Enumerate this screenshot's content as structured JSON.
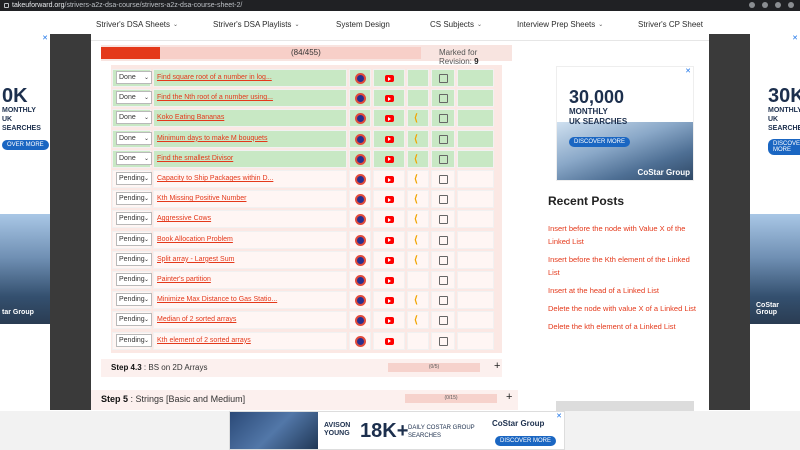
{
  "browser": {
    "url_host": "takeuforward.org",
    "url_path": "/strivers-a2z-dsa-course/strivers-a2z-dsa-course-sheet-2/"
  },
  "nav": {
    "items": [
      {
        "label": "Striver's DSA Sheets",
        "has_menu": true
      },
      {
        "label": "Striver's DSA Playlists",
        "has_menu": true
      },
      {
        "label": "System Design",
        "has_menu": false
      },
      {
        "label": "CS Subjects",
        "has_menu": true
      },
      {
        "label": "Interview Prep Sheets",
        "has_menu": true
      },
      {
        "label": "Striver's CP Sheet",
        "has_menu": false
      }
    ]
  },
  "progress": {
    "text": "(84/455)",
    "fraction": 0.1846,
    "revision_label": "Marked for Revision:",
    "revision_count": "9"
  },
  "problems": [
    {
      "status": "Done",
      "title": "Find square root of a number in log...",
      "leetcode": false
    },
    {
      "status": "Done",
      "title": "Find the Nth root of a number using...",
      "leetcode": false
    },
    {
      "status": "Done",
      "title": "Koko Eating Bananas",
      "leetcode": true
    },
    {
      "status": "Done",
      "title": "Minimum days to make M bouquets",
      "leetcode": true
    },
    {
      "status": "Done",
      "title": "Find the smallest Divisor",
      "leetcode": true
    },
    {
      "status": "Pending",
      "title": "Capacity to Ship Packages within D...",
      "leetcode": true
    },
    {
      "status": "Pending",
      "title": "Kth Missing Positive Number",
      "leetcode": true
    },
    {
      "status": "Pending",
      "title": "Aggressive Cows",
      "leetcode": true
    },
    {
      "status": "Pending",
      "title": "Book Allocation Problem",
      "leetcode": true
    },
    {
      "status": "Pending",
      "title": "Split array - Largest Sum",
      "leetcode": true
    },
    {
      "status": "Pending",
      "title": "Painter's partition",
      "leetcode": false
    },
    {
      "status": "Pending",
      "title": "Minimize Max Distance to Gas Statio...",
      "leetcode": true
    },
    {
      "status": "Pending",
      "title": "Median of 2 sorted arrays",
      "leetcode": true
    },
    {
      "status": "Pending",
      "title": "Kth element of 2 sorted arrays",
      "leetcode": false
    }
  ],
  "icons": {
    "code": "coding-ninjas-icon",
    "video": "youtube-icon",
    "leetcode": "leetcode-icon",
    "note": "notes-icon"
  },
  "steps": [
    {
      "prefix": "Step 4.3",
      "title": "BS on 2D Arrays",
      "count": "(0/5)",
      "fraction": 0
    },
    {
      "prefix": "Step 5",
      "title": "Strings [Basic and Medium]",
      "count": "(0/15)",
      "fraction": 0
    }
  ],
  "sidebar": {
    "ad": {
      "big": "30,000",
      "line1": "MONTHLY",
      "line2": "UK SEARCHES",
      "cta": "DISCOVER MORE",
      "brand": "CoStar Group"
    },
    "recent_title": "Recent Posts",
    "recent_posts": [
      "Insert before the node with Value X of the Linked List",
      "Insert before the Kth element of the Linked List",
      "Insert at the head of a Linked List",
      "Delete the node with value X of a Linked List",
      "Delete the kth element of a Linked List"
    ]
  },
  "left_ad": {
    "big": "0K",
    "line1": "MONTHLY",
    "line2": "UK SEARCHES",
    "cta": "OVER MORE",
    "brand": "tar Group"
  },
  "right_ad": {
    "big": "30K",
    "line1": "MONTHLY",
    "line2": "UK SEARCHES",
    "cta": "DISCOVER MORE",
    "brand": "CoStar Group"
  },
  "bottom_ad": {
    "avison": "AVISON YOUNG",
    "big": "18K+",
    "small": "DAILY COSTAR GROUP SEARCHES",
    "brand": "CoStar Group",
    "cta": "DISCOVER MORE"
  },
  "colors": {
    "accent": "#e4381a",
    "done_row": "#c8e8c4",
    "pending_row": "#fff6f4",
    "link": "#e4381a"
  }
}
